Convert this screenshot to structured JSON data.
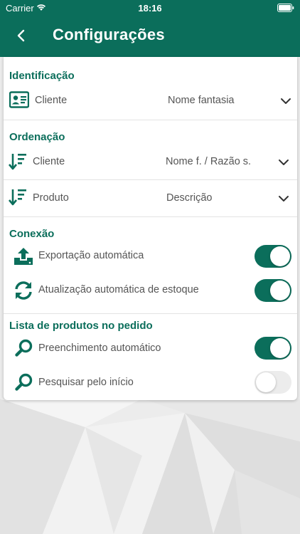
{
  "status_bar": {
    "carrier": "Carrier",
    "time": "18:16"
  },
  "header": {
    "title": "Configurações"
  },
  "sections": {
    "identificacao": {
      "title": "Identificação",
      "cliente": {
        "label": "Cliente",
        "value": "Nome fantasia"
      }
    },
    "ordenacao": {
      "title": "Ordenação",
      "cliente": {
        "label": "Cliente",
        "value": "Nome f. / Razão s."
      },
      "produto": {
        "label": "Produto",
        "value": "Descrição"
      }
    },
    "conexao": {
      "title": "Conexão",
      "exportacao": {
        "label": "Exportação automática",
        "enabled": true
      },
      "atualizacao": {
        "label": "Atualização automática de estoque",
        "enabled": true
      }
    },
    "lista_produtos": {
      "title": "Lista de produtos no pedido",
      "preenchimento": {
        "label": "Preenchimento automático",
        "enabled": true
      },
      "pesquisar": {
        "label": "Pesquisar pelo início",
        "enabled": false
      }
    }
  },
  "colors": {
    "primary": "#0b6e5b",
    "text": "#555555",
    "toggle_off": "#ececec"
  },
  "icons": [
    "back-arrow-icon",
    "wifi-icon",
    "battery-icon",
    "id-card-icon",
    "sort-descending-icon",
    "upload-icon",
    "sync-icon",
    "search-icon",
    "chevron-down-icon"
  ]
}
